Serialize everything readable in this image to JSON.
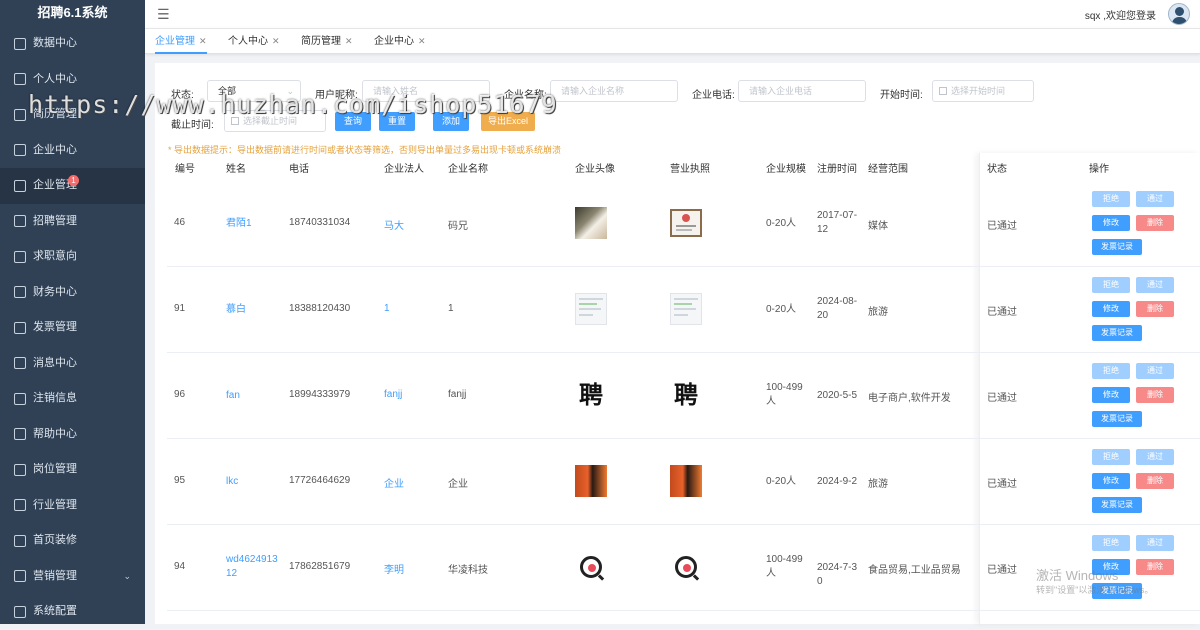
{
  "app": {
    "title": "招聘6.1系统"
  },
  "sidebar": {
    "items": [
      {
        "label": "数据中心",
        "icon": "monitor-icon"
      },
      {
        "label": "个人中心",
        "icon": "user-icon"
      },
      {
        "label": "简历管理",
        "icon": "document-icon"
      },
      {
        "label": "企业中心",
        "icon": "person-tie-icon"
      },
      {
        "label": "企业管理",
        "icon": "cube-icon",
        "badge": "1",
        "active": true
      },
      {
        "label": "招聘管理",
        "icon": "grid-icon"
      },
      {
        "label": "求职意向",
        "icon": "list-icon"
      },
      {
        "label": "财务中心",
        "icon": "wallet-icon"
      },
      {
        "label": "发票管理",
        "icon": "clipboard-icon"
      },
      {
        "label": "消息中心",
        "icon": "message-icon"
      },
      {
        "label": "注销信息",
        "icon": "edit-icon"
      },
      {
        "label": "帮助中心",
        "icon": "menu-list-icon"
      },
      {
        "label": "岗位管理",
        "icon": "home-icon"
      },
      {
        "label": "行业管理",
        "icon": "compass-icon"
      },
      {
        "label": "首页装修",
        "icon": "layout-icon"
      },
      {
        "label": "营销管理",
        "icon": "grid-list-icon",
        "expandable": true
      },
      {
        "label": "系统配置",
        "icon": "settings-icon"
      }
    ]
  },
  "header": {
    "user_text": "sqx ,欢迎您登录"
  },
  "tabs": [
    {
      "label": "企业管理",
      "active": true
    },
    {
      "label": "个人中心"
    },
    {
      "label": "简历管理"
    },
    {
      "label": "企业中心"
    }
  ],
  "filters": {
    "status_label": "状态:",
    "status_value": "全部",
    "nickname_label": "用户昵称:",
    "nickname_placeholder": "请输入姓名",
    "company_label": "企业名称:",
    "company_placeholder": "请输入企业名称",
    "phone_label": "企业电话:",
    "phone_placeholder": "请输入企业电话",
    "start_label": "开始时间:",
    "start_placeholder": "选择开始时间",
    "end_label": "截止时间:",
    "end_placeholder": "选择截止时间",
    "query_btn": "查询",
    "reset_btn": "重置",
    "add_btn": "添加",
    "export_btn": "导出Excel"
  },
  "tip": "* 导出数据提示：导出数据前请进行时间或者状态等筛选，否则导出单量过多易出现卡顿或系统崩溃",
  "table": {
    "headers": [
      "编号",
      "姓名",
      "电话",
      "企业法人",
      "企业名称",
      "企业头像",
      "营业执照",
      "企业规模",
      "注册时间",
      "经营范围",
      "状态",
      "操作"
    ],
    "rows": [
      {
        "id": "46",
        "name": "君陌1",
        "phone": "18740331034",
        "legal": "马大",
        "company": "码兄",
        "avatar": "photo",
        "license": "license",
        "size": "0-20人",
        "reg_date": "2017-07-12",
        "scope": "媒体",
        "status": "已通过"
      },
      {
        "id": "91",
        "name": "慕白",
        "phone": "18388120430",
        "legal": "1",
        "company": "1",
        "avatar": "screenshot",
        "license": "screenshot",
        "size": "0-20人",
        "reg_date": "2024-08-20",
        "scope": "旅游",
        "status": "已通过"
      },
      {
        "id": "96",
        "name": "fan",
        "phone": "18994333979",
        "legal": "fanjj",
        "company": "fanjj",
        "avatar": "pin-char",
        "license": "pin-char",
        "size": "100-499人",
        "reg_date": "2020-5-5",
        "scope": "电子商户,软件开发",
        "status": "已通过"
      },
      {
        "id": "95",
        "name": "lkc",
        "phone": "17726464629",
        "legal": "企业",
        "company": "企业",
        "avatar": "orange",
        "license": "orange",
        "size": "0-20人",
        "reg_date": "2024-9-2",
        "scope": "旅游",
        "status": "已通过"
      },
      {
        "id": "94",
        "name": "wd462491312",
        "phone": "17862851679",
        "legal": "李明",
        "company": "华凌科技",
        "avatar": "q-logo",
        "license": "q-logo",
        "size": "100-499人",
        "reg_date": "2024-7-30",
        "scope": "食品贸易,工业品贸易",
        "status": "已通过"
      }
    ],
    "actions": {
      "reject": "拒绝",
      "approve": "通过",
      "edit": "修改",
      "delete": "删除",
      "invoice": "发票记录"
    }
  },
  "pin_char": "聘",
  "watermark": "https://www.huzhan.com/ishop51679",
  "windows_activation": {
    "line1": "激活 Windows",
    "line2": "转到\"设置\"以激活 Windows。"
  }
}
